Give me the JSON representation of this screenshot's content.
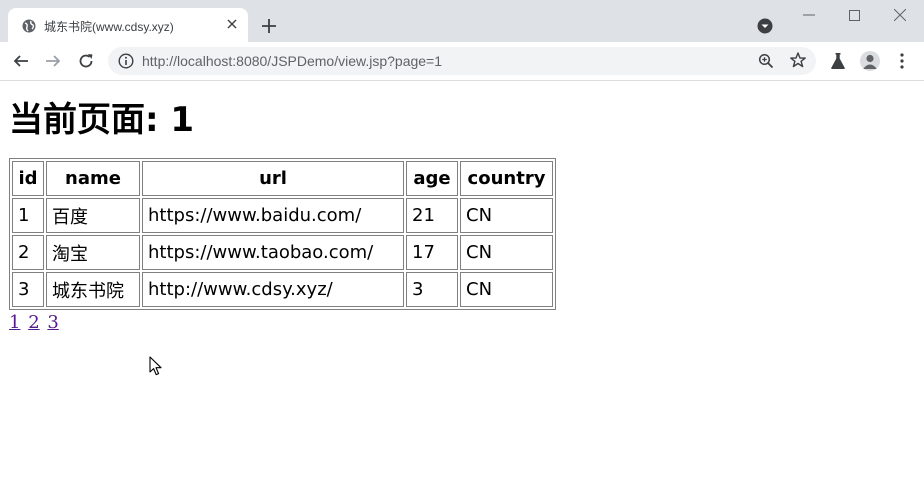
{
  "tab": {
    "title": "城东书院(www.cdsy.xyz)"
  },
  "address_bar": {
    "url": "http://localhost:8080/JSPDemo/view.jsp?page=1"
  },
  "page": {
    "heading": "当前页面: 1",
    "table": {
      "headers": [
        "id",
        "name",
        "url",
        "age",
        "country"
      ],
      "rows": [
        [
          "1",
          "百度",
          "https://www.baidu.com/",
          "21",
          "CN"
        ],
        [
          "2",
          "淘宝",
          "https://www.taobao.com/",
          "17",
          "CN"
        ],
        [
          "3",
          "城东书院",
          "http://www.cdsy.xyz/",
          "3",
          "CN"
        ]
      ]
    },
    "pagination": [
      "1",
      "2",
      "3"
    ]
  },
  "icons": {
    "favicon": "globe-icon",
    "tab_close": "close-icon",
    "new_tab": "plus-icon",
    "tab_search": "chevron-down-circle-icon",
    "back": "back-arrow-icon",
    "forward": "forward-arrow-icon",
    "reload": "reload-icon",
    "site_info": "info-icon",
    "zoom": "zoom-icon",
    "bookmark": "star-icon",
    "extension": "flask-icon",
    "profile": "account-icon",
    "menu": "kebab-menu-icon"
  },
  "colors": {
    "visited_link": "#551a8b",
    "chrome_bg": "#dee1e6",
    "omnibox_bg": "#f1f3f4"
  }
}
